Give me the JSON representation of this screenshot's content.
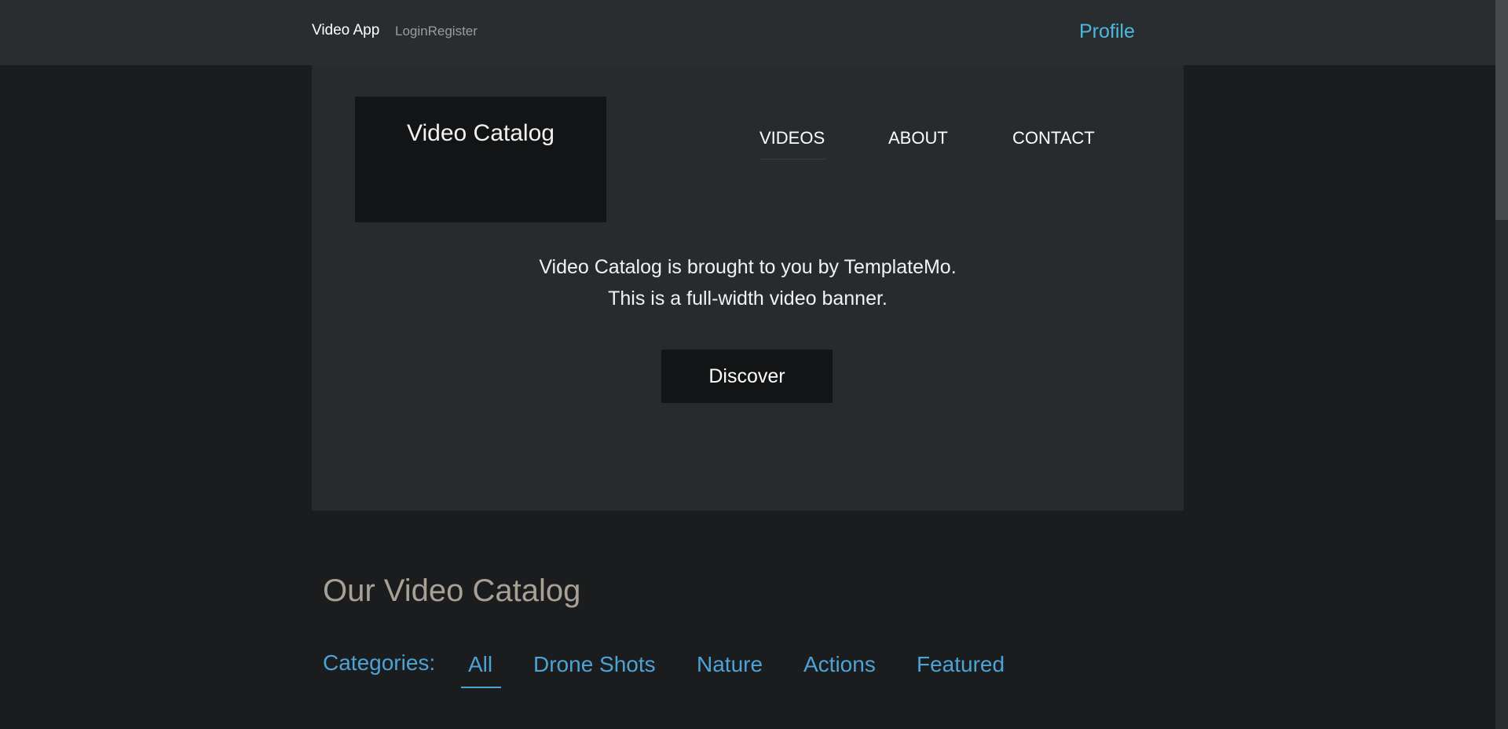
{
  "topbar": {
    "brand": "Video App",
    "login": "Login",
    "register": "Register",
    "profile": "Profile"
  },
  "hero": {
    "logo_text": "Video Catalog",
    "nav": [
      "VIDEOS",
      "ABOUT",
      "CONTACT"
    ],
    "line1": "Video Catalog is brought to you by TemplateMo.",
    "line2": "This is a full-width video banner.",
    "discover_label": "Discover"
  },
  "catalog": {
    "title": "Our Video Catalog",
    "categories_label": "Categories:",
    "tabs": [
      "All",
      "Drone Shots",
      "Nature",
      "Actions",
      "Featured"
    ],
    "active_tab": "All"
  },
  "colors": {
    "accent": "#4ba3d6",
    "profile": "#4cb8e0",
    "background": "#1b1c1e",
    "hero_bg": "#282b2e",
    "topbar_bg": "#2a2d30"
  }
}
